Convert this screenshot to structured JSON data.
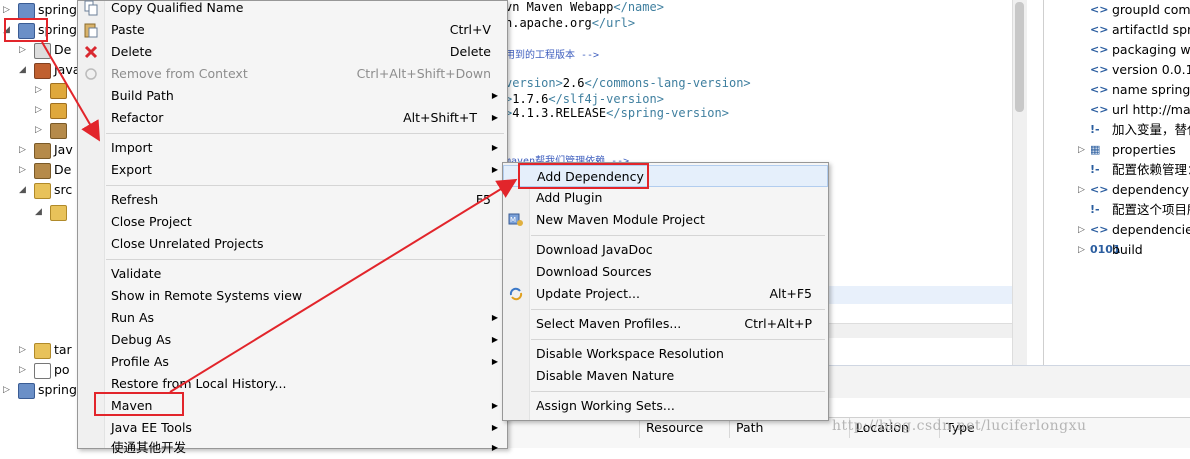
{
  "tree": [
    {
      "label": "spring",
      "indent": 0,
      "icon": "proj"
    },
    {
      "label": "spring",
      "indent": 0,
      "icon": "proj"
    },
    {
      "label": "De",
      "indent": 1,
      "icon": "num"
    },
    {
      "label": "Java",
      "indent": 1,
      "icon": "java"
    },
    {
      "label": "",
      "indent": 2,
      "icon": "pkg"
    },
    {
      "label": "",
      "indent": 2,
      "icon": "pkg"
    },
    {
      "label": "",
      "indent": 2,
      "icon": "lib"
    },
    {
      "label": "Jav",
      "indent": 1,
      "icon": "lib"
    },
    {
      "label": "De",
      "indent": 1,
      "icon": "lib"
    },
    {
      "label": "src",
      "indent": 1,
      "icon": "folder"
    },
    {
      "label": "",
      "indent": 2,
      "icon": "folder"
    },
    {
      "label": "tar",
      "indent": 1,
      "icon": "folder"
    },
    {
      "label": "po",
      "indent": 1,
      "icon": "file"
    },
    {
      "label": "spring",
      "indent": 0,
      "icon": "proj"
    }
  ],
  "editor": {
    "lines": [
      {
        "tag1": "vn Maven Webapp",
        "closetag": "</name>"
      },
      {
        "tag1": "n.apache.org",
        "closetag": "</url>"
      },
      {
        "comment": "用到的工程版本 -->"
      },
      {
        "open": "version>",
        "val": "2.6",
        "closetag": "</commons-lang-version>"
      },
      {
        "open": ">",
        "val": "1.7.6",
        "closetag": "</slf4j-version>"
      },
      {
        "open": ">",
        "val": "4.1.3.RELEASE",
        "closetag": "</spring-version>"
      },
      {
        "comment": "maven帮我们管理依赖 -->"
      }
    ]
  },
  "outline": [
    {
      "icon": "<>",
      "text": "groupId  com"
    },
    {
      "icon": "<>",
      "text": "artifactId  spr"
    },
    {
      "icon": "<>",
      "text": "packaging  w"
    },
    {
      "icon": "<>",
      "text": "version  0.0.1-"
    },
    {
      "icon": "<>",
      "text": "name  spring"
    },
    {
      "icon": "<>",
      "text": "url  http://mav"
    },
    {
      "icon": "!-",
      "text": "加入变量，替代"
    },
    {
      "icon": "▦",
      "text": "properties",
      "twisty": true
    },
    {
      "icon": "!-",
      "text": "配置依赖管理："
    },
    {
      "icon": "<>",
      "text": "dependencyM",
      "twisty": true
    },
    {
      "icon": "!-",
      "text": "配置这个项目所"
    },
    {
      "icon": "<>",
      "text": "dependencies",
      "twisty": true
    },
    {
      "icon": "0101",
      "text": "build",
      "twisty": true
    }
  ],
  "table_headers": [
    "Resource",
    "Path",
    "Location",
    "Type"
  ],
  "menu": {
    "items": [
      {
        "label": "Copy Qualified Name",
        "accel": "",
        "sub": false,
        "icon": "copy"
      },
      {
        "label": "Paste",
        "accel": "Ctrl+V",
        "sub": false,
        "icon": "paste"
      },
      {
        "label": "Delete",
        "accel": "Delete",
        "sub": false,
        "icon": "delete"
      },
      {
        "label": "Remove from Context",
        "accel": "Ctrl+Alt+Shift+Down",
        "sub": false,
        "icon": "remove",
        "disabled": true
      },
      {
        "label": "Build Path",
        "accel": "",
        "sub": true
      },
      {
        "label": "Refactor",
        "accel": "Alt+Shift+T",
        "sub": true
      },
      {
        "sep": true
      },
      {
        "label": "Import",
        "accel": "",
        "sub": true
      },
      {
        "label": "Export",
        "accel": "",
        "sub": true
      },
      {
        "sep": true
      },
      {
        "label": "Refresh",
        "accel": "F5",
        "sub": false
      },
      {
        "label": "Close Project",
        "accel": "",
        "sub": false
      },
      {
        "label": "Close Unrelated Projects",
        "accel": "",
        "sub": false
      },
      {
        "sep": true
      },
      {
        "label": "Validate",
        "accel": "",
        "sub": false
      },
      {
        "label": "Show in Remote Systems view",
        "accel": "",
        "sub": false
      },
      {
        "label": "Run As",
        "accel": "",
        "sub": true
      },
      {
        "label": "Debug As",
        "accel": "",
        "sub": true
      },
      {
        "label": "Profile As",
        "accel": "",
        "sub": true
      },
      {
        "label": "Restore from Local History...",
        "accel": "",
        "sub": false
      },
      {
        "label": "Maven",
        "accel": "",
        "sub": true
      },
      {
        "label": "Java EE Tools",
        "accel": "",
        "sub": true
      },
      {
        "label": "使通其他开发",
        "accel": "",
        "sub": true
      }
    ]
  },
  "submenu": {
    "items": [
      {
        "label": "Add Dependency",
        "accel": "",
        "active": true
      },
      {
        "label": "Add Plugin",
        "accel": ""
      },
      {
        "label": "New Maven Module Project",
        "accel": "",
        "icon": "maven"
      },
      {
        "sep": true
      },
      {
        "label": "Download JavaDoc",
        "accel": ""
      },
      {
        "label": "Download Sources",
        "accel": ""
      },
      {
        "label": "Update Project...",
        "accel": "Alt+F5",
        "icon": "update"
      },
      {
        "sep": true
      },
      {
        "label": "Select Maven Profiles...",
        "accel": "Ctrl+Alt+P"
      },
      {
        "sep": true
      },
      {
        "label": "Disable Workspace Resolution",
        "accel": ""
      },
      {
        "label": "Disable Maven Nature",
        "accel": ""
      },
      {
        "sep": true
      },
      {
        "label": "Assign Working Sets...",
        "accel": ""
      }
    ]
  },
  "watermark": "http://blog.csdn.net/luciferlongxu",
  "colors": {
    "highlight_red": "#e2252b",
    "menu_bg": "#f5f5f5",
    "active_item": "#e5effb"
  }
}
